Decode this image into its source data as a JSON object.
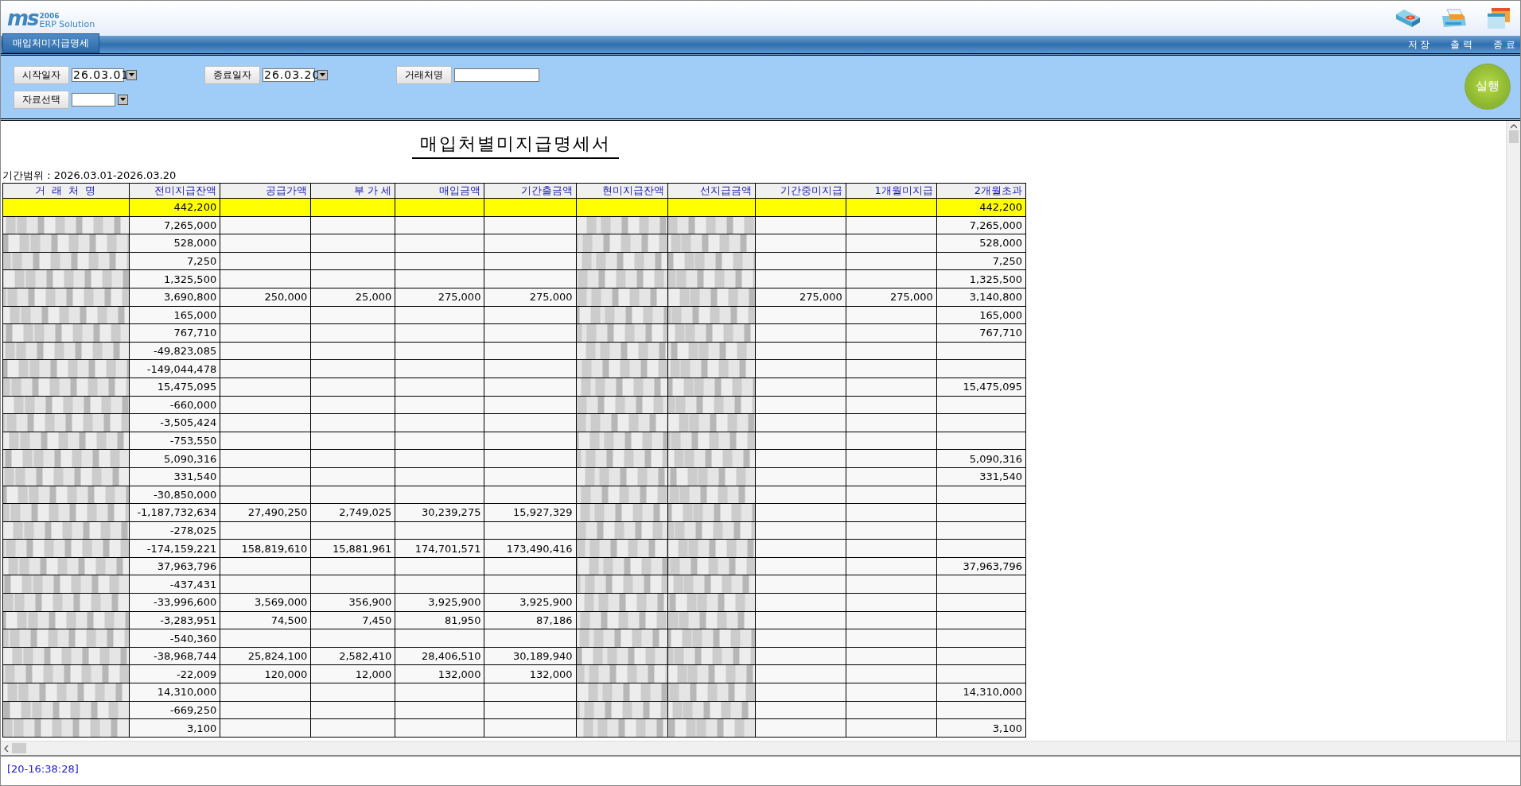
{
  "app": {
    "logo_mark": "ms",
    "logo_year": "2006",
    "logo_text": "ERP Solution"
  },
  "tabs": [
    {
      "label": "매입처미지급명세",
      "selected": true
    }
  ],
  "toolbar": [
    {
      "kind": "save",
      "label": "저 장"
    },
    {
      "kind": "print",
      "label": "출 력"
    },
    {
      "kind": "exit",
      "label": "종 료"
    }
  ],
  "filters": [
    {
      "kind": "date",
      "label": "시작일자",
      "value": "26.03.01"
    },
    {
      "kind": "date",
      "label": "종료일자",
      "value": "26.03.20"
    },
    {
      "kind": "text",
      "label": "거래처명"
    },
    {
      "kind": "select",
      "label": "자료선택"
    }
  ],
  "run_button": "실행",
  "report": {
    "title": "매입처별미지급명세서",
    "period": "기간범위 : 2026.03.01-2026.03.20",
    "columns": [
      {
        "label": "거 래 처 명",
        "masked": true
      },
      {
        "label": "전미지급잔액",
        "masked": false
      },
      {
        "label": "공급가액",
        "masked": false
      },
      {
        "label": "부 가 세",
        "masked": false
      },
      {
        "label": "매입금액",
        "masked": false
      },
      {
        "label": "기간출금액",
        "masked": false
      },
      {
        "label": "현미지급잔액",
        "masked": true
      },
      {
        "label": "선지급금액",
        "masked": true
      },
      {
        "label": "기간중미지급",
        "masked": false
      },
      {
        "label": "1개월미지급",
        "masked": false
      },
      {
        "label": "2개월초과",
        "masked": false
      }
    ],
    "rows": [
      {
        "selected": true,
        "cells": [
          null,
          "442,200",
          null,
          null,
          null,
          null,
          null,
          null,
          null,
          null,
          "442,200"
        ]
      },
      {
        "selected": false,
        "cells": [
          null,
          "7,265,000",
          null,
          null,
          null,
          null,
          null,
          null,
          null,
          null,
          "7,265,000"
        ]
      },
      {
        "selected": false,
        "cells": [
          null,
          "528,000",
          null,
          null,
          null,
          null,
          null,
          null,
          null,
          null,
          "528,000"
        ]
      },
      {
        "selected": false,
        "cells": [
          null,
          "7,250",
          null,
          null,
          null,
          null,
          null,
          null,
          null,
          null,
          "7,250"
        ]
      },
      {
        "selected": false,
        "cells": [
          null,
          "1,325,500",
          null,
          null,
          null,
          null,
          null,
          null,
          null,
          null,
          "1,325,500"
        ]
      },
      {
        "selected": false,
        "cells": [
          null,
          "3,690,800",
          "250,000",
          "25,000",
          "275,000",
          "275,000",
          null,
          null,
          "275,000",
          "275,000",
          "3,140,800"
        ]
      },
      {
        "selected": false,
        "cells": [
          null,
          "165,000",
          null,
          null,
          null,
          null,
          null,
          null,
          null,
          null,
          "165,000"
        ]
      },
      {
        "selected": false,
        "cells": [
          null,
          "767,710",
          null,
          null,
          null,
          null,
          null,
          null,
          null,
          null,
          "767,710"
        ]
      },
      {
        "selected": false,
        "cells": [
          null,
          "-49,823,085",
          null,
          null,
          null,
          null,
          null,
          null,
          null,
          null,
          null
        ]
      },
      {
        "selected": false,
        "cells": [
          null,
          "-149,044,478",
          null,
          null,
          null,
          null,
          null,
          null,
          null,
          null,
          null
        ]
      },
      {
        "selected": false,
        "cells": [
          null,
          "15,475,095",
          null,
          null,
          null,
          null,
          null,
          null,
          null,
          null,
          "15,475,095"
        ]
      },
      {
        "selected": false,
        "cells": [
          null,
          "-660,000",
          null,
          null,
          null,
          null,
          null,
          null,
          null,
          null,
          null
        ]
      },
      {
        "selected": false,
        "cells": [
          null,
          "-3,505,424",
          null,
          null,
          null,
          null,
          null,
          null,
          null,
          null,
          null
        ]
      },
      {
        "selected": false,
        "cells": [
          null,
          "-753,550",
          null,
          null,
          null,
          null,
          null,
          null,
          null,
          null,
          null
        ]
      },
      {
        "selected": false,
        "cells": [
          null,
          "5,090,316",
          null,
          null,
          null,
          null,
          null,
          null,
          null,
          null,
          "5,090,316"
        ]
      },
      {
        "selected": false,
        "cells": [
          null,
          "331,540",
          null,
          null,
          null,
          null,
          null,
          null,
          null,
          null,
          "331,540"
        ]
      },
      {
        "selected": false,
        "cells": [
          null,
          "-30,850,000",
          null,
          null,
          null,
          null,
          null,
          null,
          null,
          null,
          null
        ]
      },
      {
        "selected": false,
        "cells": [
          null,
          "-1,187,732,634",
          "27,490,250",
          "2,749,025",
          "30,239,275",
          "15,927,329",
          null,
          null,
          null,
          null,
          null
        ]
      },
      {
        "selected": false,
        "cells": [
          null,
          "-278,025",
          null,
          null,
          null,
          null,
          null,
          null,
          null,
          null,
          null
        ]
      },
      {
        "selected": false,
        "cells": [
          null,
          "-174,159,221",
          "158,819,610",
          "15,881,961",
          "174,701,571",
          "173,490,416",
          null,
          null,
          null,
          null,
          null
        ]
      },
      {
        "selected": false,
        "cells": [
          null,
          "37,963,796",
          null,
          null,
          null,
          null,
          null,
          null,
          null,
          null,
          "37,963,796"
        ]
      },
      {
        "selected": false,
        "cells": [
          null,
          "-437,431",
          null,
          null,
          null,
          null,
          null,
          null,
          null,
          null,
          null
        ]
      },
      {
        "selected": false,
        "cells": [
          null,
          "-33,996,600",
          "3,569,000",
          "356,900",
          "3,925,900",
          "3,925,900",
          null,
          null,
          null,
          null,
          null
        ]
      },
      {
        "selected": false,
        "cells": [
          null,
          "-3,283,951",
          "74,500",
          "7,450",
          "81,950",
          "87,186",
          null,
          null,
          null,
          null,
          null
        ]
      },
      {
        "selected": false,
        "cells": [
          null,
          "-540,360",
          null,
          null,
          null,
          null,
          null,
          null,
          null,
          null,
          null
        ]
      },
      {
        "selected": false,
        "cells": [
          null,
          "-38,968,744",
          "25,824,100",
          "2,582,410",
          "28,406,510",
          "30,189,940",
          null,
          null,
          null,
          null,
          null
        ]
      },
      {
        "selected": false,
        "cells": [
          null,
          "-22,009",
          "120,000",
          "12,000",
          "132,000",
          "132,000",
          null,
          null,
          null,
          null,
          null
        ]
      },
      {
        "selected": false,
        "cells": [
          null,
          "14,310,000",
          null,
          null,
          null,
          null,
          null,
          null,
          null,
          null,
          "14,310,000"
        ]
      },
      {
        "selected": false,
        "cells": [
          null,
          "-669,250",
          null,
          null,
          null,
          null,
          null,
          null,
          null,
          null,
          null
        ]
      },
      {
        "selected": false,
        "cells": [
          null,
          "3,100",
          null,
          null,
          null,
          null,
          null,
          null,
          null,
          null,
          "3,100"
        ]
      }
    ]
  },
  "status": "[20-16:38:28]"
}
